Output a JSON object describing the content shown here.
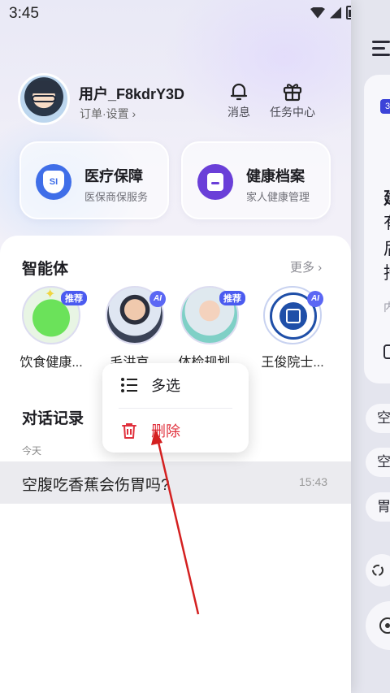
{
  "status_bar": {
    "time": "3:45"
  },
  "profile": {
    "username": "用户_F8kdrY3D",
    "subtitle": "订单·设置 ›"
  },
  "top_actions": [
    {
      "label": "消息",
      "icon": "bell-icon"
    },
    {
      "label": "任务中心",
      "icon": "gift-icon"
    }
  ],
  "quick_cards": [
    {
      "title": "医疗保障",
      "subtitle": "医保商保服务",
      "icon": "insurance-icon",
      "icon_text": "SI",
      "color": "#3f6ee8"
    },
    {
      "title": "健康档案",
      "subtitle": "家人健康管理",
      "icon": "health-record-icon",
      "color": "#6a3fd8"
    }
  ],
  "agents_section": {
    "title": "智能体",
    "more_label": "更多 ›",
    "agents": [
      {
        "name": "饮食健康...",
        "badge": "推荐"
      },
      {
        "name": "毛洪京...",
        "badge": "AI"
      },
      {
        "name": "体检规划...",
        "badge": "推荐"
      },
      {
        "name": "王俊院士...",
        "badge": "AI"
      }
    ]
  },
  "history": {
    "title": "对话记录",
    "group_label": "今天",
    "items": [
      {
        "question": "空腹吃香蕉会伤胃吗?",
        "time": "15:43"
      }
    ]
  },
  "context_menu": {
    "multi_select": "多选",
    "delete": "删除"
  },
  "background_panel": {
    "badge": "3",
    "text_fragments": [
      "建",
      "有",
      "后",
      "持"
    ],
    "faded_fragment": "内",
    "chips": [
      "空",
      "空",
      "胃"
    ]
  },
  "colors": {
    "accent": "#4b5bf0",
    "delete": "#e0303c",
    "annotation_arrow": "#d42020"
  }
}
